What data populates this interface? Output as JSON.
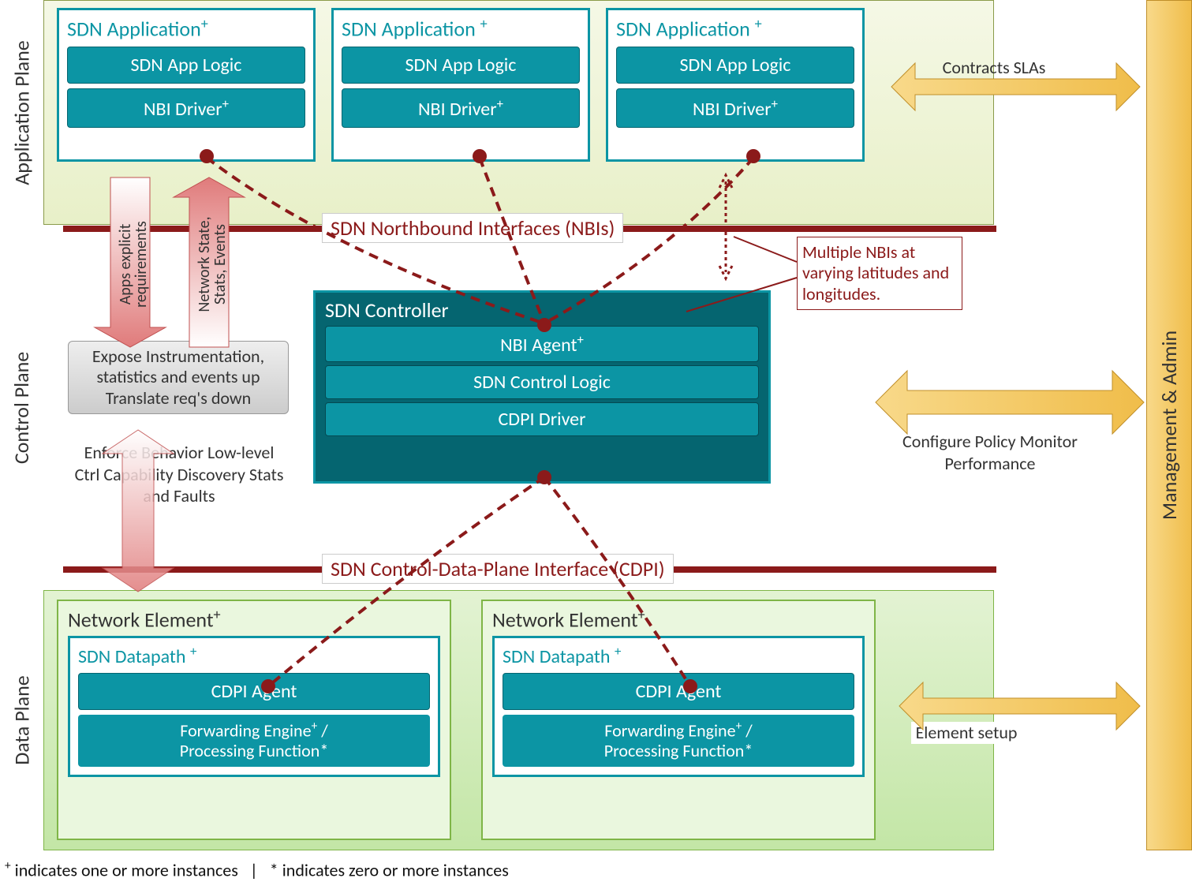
{
  "planes": {
    "app": "Application Plane",
    "ctrl": "Control Plane",
    "data": "Data Plane"
  },
  "mgmt_label": "Management & Admin",
  "apps": {
    "title": "SDN Application",
    "logic": "SDN App Logic",
    "nbi_driver": "NBI Driver"
  },
  "interfaces": {
    "nbi": "SDN Northbound Interfaces (NBIs)",
    "cdpi": "SDN Control-Data-Plane Interface (CDPI)"
  },
  "controller": {
    "title": "SDN Controller",
    "nbi_agent": "NBI Agent",
    "logic": "SDN Control Logic",
    "cdpi_driver": "CDPI Driver"
  },
  "annotations": {
    "apps_req": "Apps explicit requirements",
    "net_state": "Network State, Stats, Events",
    "expose": "Expose Instrumentation, statistics and events up Translate req's down",
    "enforce": "Enforce Behavior Low-level Ctrl Capability Discovery Stats and Faults",
    "multi_nbi": "Multiple NBIs at varying latitudes and longitudes.",
    "contracts": "Contracts SLAs",
    "config": "Configure Policy Monitor Performance",
    "elem_setup": "Element setup"
  },
  "net_elem": {
    "title": "Network Element",
    "datapath": "SDN Datapath",
    "cdpi_agent": "CDPI Agent",
    "fw_line1": "Forwarding Engine",
    "fw_line2": "Processing Function"
  },
  "footnote": {
    "plus": "indicates one or more instances",
    "star": "* indicates zero or more instances",
    "sep": "|"
  }
}
